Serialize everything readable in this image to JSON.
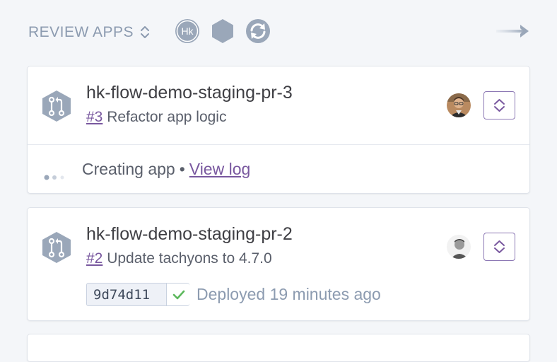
{
  "header": {
    "title": "REVIEW APPS",
    "sort_icon": "sort-icon",
    "badges": [
      {
        "name": "hk-badge",
        "label": "Hk"
      },
      {
        "name": "hexagon-badge",
        "label": ""
      },
      {
        "name": "sync-icon",
        "label": ""
      }
    ],
    "arrow_icon": "arrow-right-icon"
  },
  "apps": [
    {
      "name": "hk-flow-demo-staging-pr-3",
      "pr_number": "#3",
      "pr_title": "Refactor app logic",
      "status": "Creating app",
      "separator": "•",
      "view_log_label": "View log"
    },
    {
      "name": "hk-flow-demo-staging-pr-2",
      "pr_number": "#2",
      "pr_title": "Update tachyons to 4.7.0",
      "commit_sha": "9d74d11",
      "deploy_status": "Deployed 19 minutes ago"
    }
  ],
  "colors": {
    "accent": "#79589f",
    "muted": "#8c9bb0",
    "success": "#5cb85c",
    "background": "#f4f6f9"
  }
}
